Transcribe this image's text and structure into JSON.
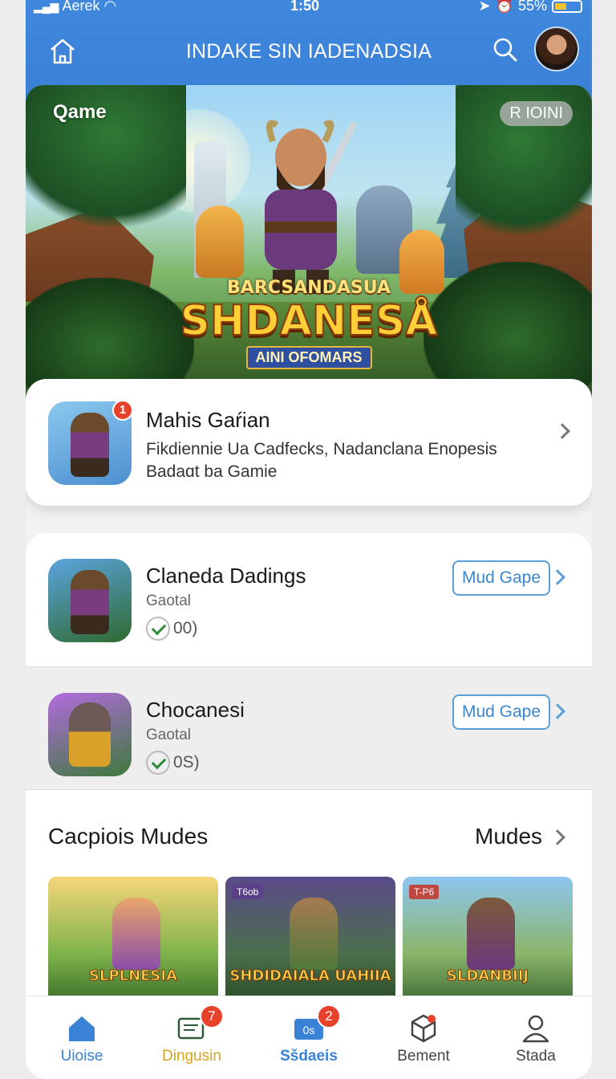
{
  "status_bar": {
    "carrier": "Aerek",
    "time": "1:50",
    "battery": "55%"
  },
  "header": {
    "title": "INDAKE SIN IADENADSIA"
  },
  "hero": {
    "corner_label": "Qame",
    "badge": "R IOINI",
    "logo_top": "BARCSANDASUA",
    "logo_main": "SHDANESÅ",
    "logo_sub": "AINI OFOMARS"
  },
  "featured": {
    "title": "Mahis Gaŕian",
    "description": "Fikdiennie Ua Cadfecks, Nadanclana Enopesis Badaɑt ba Gamie",
    "notification_count": "1"
  },
  "list": [
    {
      "name": "Claneda Dadings",
      "subtitle": "Gaotal",
      "rating": "00)",
      "button": "Mud Gape"
    },
    {
      "name": "Chocanesi",
      "subtitle": "Gaotal",
      "rating": "0S)",
      "button": "Mud Gape"
    }
  ],
  "section": {
    "title": "Cacpiois Mudes",
    "more": "Mudes",
    "thumbnails": [
      {
        "label": "SLPLNESIA",
        "tag": ""
      },
      {
        "label": "SHDIDAIALA UAHIIA",
        "tag": "T6ob"
      },
      {
        "label": "SLDANBIIJ",
        "tag": "T-P6"
      }
    ]
  },
  "bottom_nav": [
    {
      "label": "Uioise",
      "color": "#3a82d6",
      "badge": ""
    },
    {
      "label": "Dingusin",
      "color": "#d9a21b",
      "badge": "7"
    },
    {
      "label": "Sšdaeis",
      "color": "#3a82d6",
      "badge": "2"
    },
    {
      "label": "Bement",
      "color": "#444444",
      "badge": ""
    },
    {
      "label": "Stada",
      "color": "#444444",
      "badge": ""
    }
  ],
  "colors": {
    "header_blue": "#3f88dd",
    "accent_blue": "#3b86cc",
    "badge_red": "#e6412b"
  }
}
